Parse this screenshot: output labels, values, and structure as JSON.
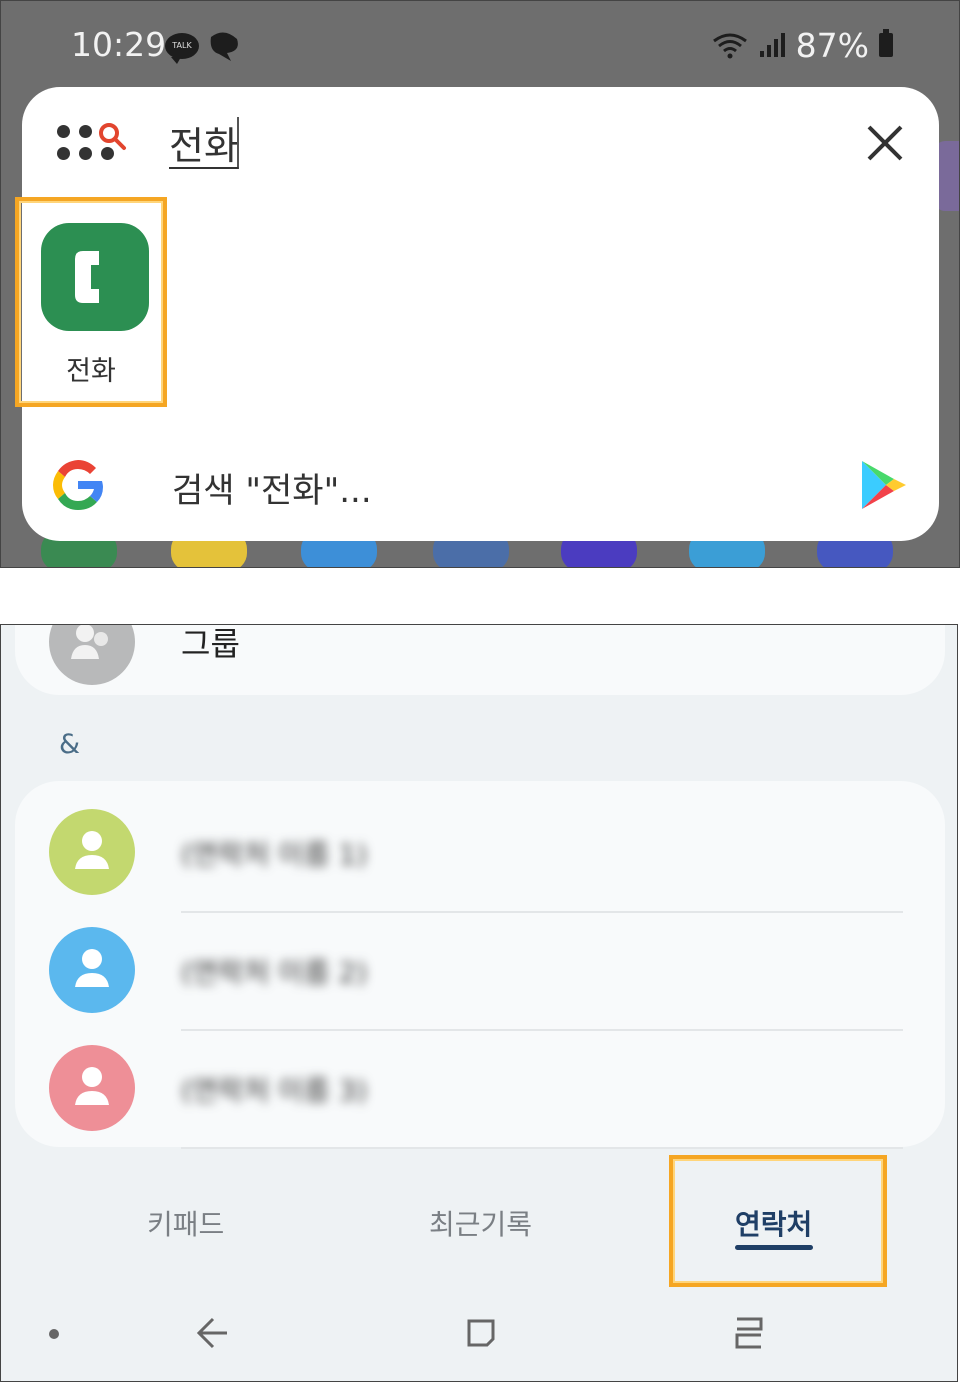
{
  "status_bar": {
    "time": "10:29",
    "talk_badge": "TALK",
    "battery": "87%"
  },
  "search": {
    "query": "전화",
    "close_icon": "close-icon",
    "app_result": {
      "label": "전화",
      "icon": "phone-app-icon",
      "icon_color": "#2c8f52"
    },
    "web_search_label": "검색 \"전화\"...",
    "google_icon": "google-icon",
    "play_store_icon": "play-store-icon"
  },
  "contacts": {
    "group_label": "그룹",
    "section_header": "&",
    "items": [
      {
        "name": "(연락처 이름 1)",
        "avatar_color": "#c3d86f"
      },
      {
        "name": "(연락처 이름 2)",
        "avatar_color": "#5bb8ee"
      },
      {
        "name": "(연락처 이름 3)",
        "avatar_color": "#ee8f97"
      }
    ]
  },
  "tabs": {
    "keypad": "키패드",
    "recents": "최근기록",
    "contacts": "연락처",
    "active": "contacts"
  },
  "nav": {
    "back_icon": "back-icon",
    "home_icon": "home-icon",
    "recents_icon": "recent-apps-icon"
  },
  "colors": {
    "highlight": "#f5a623",
    "active_tab": "#1f3f66",
    "phone_green": "#2c8f52"
  }
}
